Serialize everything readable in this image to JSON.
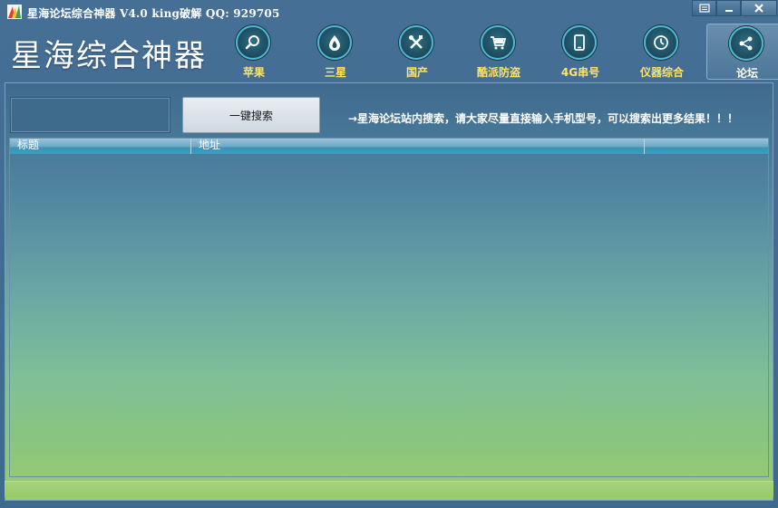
{
  "window": {
    "title": "星海论坛综合神器 V4.0  king破解  QQ: 929705",
    "controls": [
      "menu-icon",
      "minimize-icon",
      "close-icon"
    ]
  },
  "brand": {
    "title": "星海综合神器"
  },
  "nav": [
    {
      "label": "苹果",
      "icon": "search-icon"
    },
    {
      "label": "三星",
      "icon": "drop-icon"
    },
    {
      "label": "国产",
      "icon": "tools-icon"
    },
    {
      "label": "酷派防盗",
      "icon": "cart-icon"
    },
    {
      "label": "4G串号",
      "icon": "phone-icon"
    },
    {
      "label": "仪器综合",
      "icon": "clock-icon"
    },
    {
      "label": "论坛",
      "icon": "share-icon",
      "active": true
    }
  ],
  "search": {
    "value": "",
    "button_label": "一键搜索",
    "hint": "→星海论坛站内搜索，请大家尽量直接输入手机型号，可以搜索出更多结果！！！"
  },
  "table": {
    "columns": [
      "标题",
      "地址",
      ""
    ],
    "rows": []
  },
  "colors": {
    "accent": "#4fb7cf",
    "nav_label": "#ffe36a",
    "header_bg": "#416c92"
  }
}
